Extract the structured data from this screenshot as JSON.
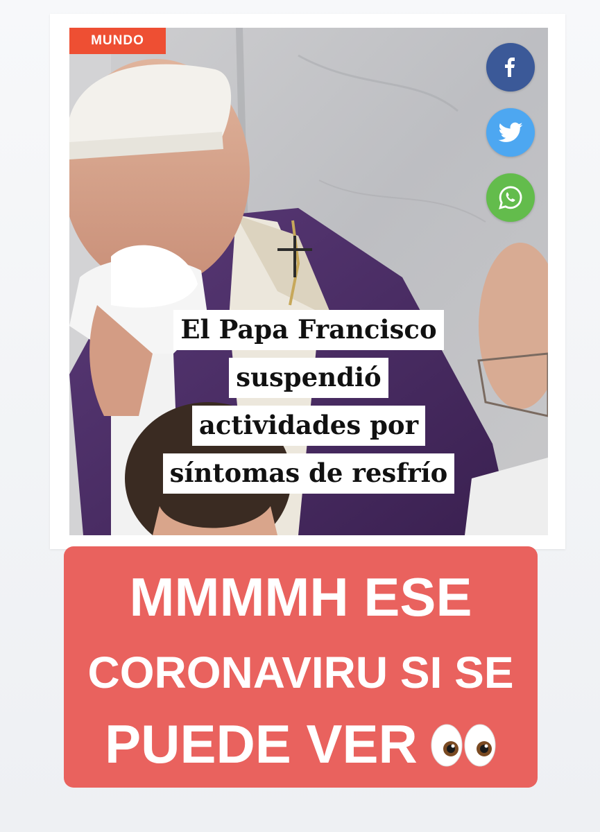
{
  "article": {
    "category": "MUNDO",
    "headline_lines": [
      "El Papa Francisco",
      "suspendió",
      "actividades por",
      "síntomas de resfrío"
    ],
    "share_buttons": [
      {
        "network": "Facebook",
        "icon": "facebook-icon",
        "color": "#3b5998"
      },
      {
        "network": "Twitter",
        "icon": "twitter-icon",
        "color": "#4da7f1"
      },
      {
        "network": "WhatsApp",
        "icon": "whatsapp-icon",
        "color": "#63bc4c"
      }
    ],
    "category_color": "#ee4f33"
  },
  "story_caption": {
    "lines": [
      "MMMMH ESE",
      "CORONAVIRU SI SE",
      "PUEDE VER"
    ],
    "emoji": "eyes-emoji",
    "background_color": "#e9625e",
    "text_color": "#ffffff"
  }
}
